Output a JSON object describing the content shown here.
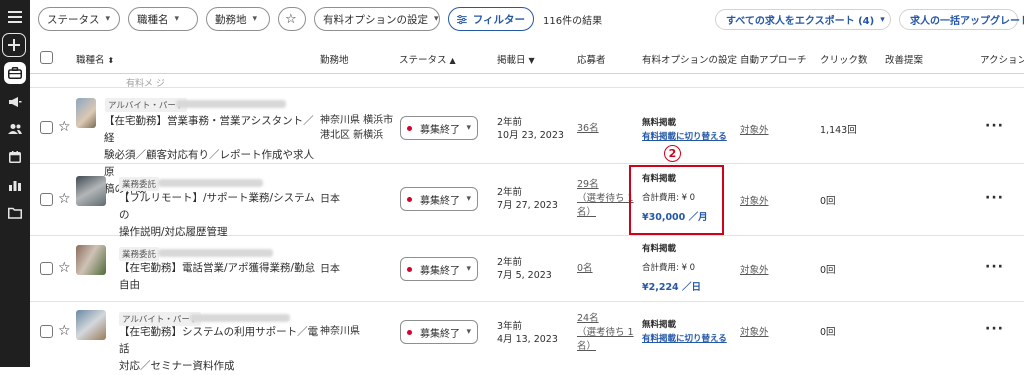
{
  "toolbar": {
    "status": "ステータス",
    "job_category": "職種名",
    "location": "勤務地",
    "paid_option": "有料オプションの設定",
    "filter": "フィルター",
    "results": "116件の結果",
    "export": "すべての求人をエクスポート (4)",
    "bulk_upgrade": "求人の一括アップグレード"
  },
  "columns": {
    "job_title": "職種名",
    "location": "勤務地",
    "status": "ステータス",
    "posted": "掲載日",
    "applicants": "応募者",
    "paid_option": "有料オプションの設定",
    "auto_approach": "自動アプローチ",
    "clicks": "クリック数",
    "suggestions": "改善提案",
    "actions": "アクション"
  },
  "partial_row_text": "有料メ ジ",
  "rows": [
    {
      "job_type": "アルバイト・パート",
      "title_l1": "【在宅勤務】営業事務・営業アシスタント／経",
      "title_l2": "験必須／顧客対応有り／レポート作成や求人原",
      "title_l3": "稿の作成",
      "loc_l1": "神奈川県 横浜市",
      "loc_l2": "港北区 新横浜",
      "status": "募集終了",
      "posted_ago": "2年前",
      "posted_date": "10月 23, 2023",
      "applicants": "36名",
      "option_l1": "無料掲載",
      "option_l2": "有料掲載に切り替える",
      "auto": "対象外",
      "clicks": "1,143回"
    },
    {
      "job_type": "業務委託",
      "title_l1": "【フルリモート】/サポート業務/システムの",
      "title_l2": "操作説明/対応履歴管理",
      "loc_l1": "日本",
      "status": "募集終了",
      "posted_ago": "2年前",
      "posted_date": "7月 27, 2023",
      "appl_l1": "29名",
      "appl_l2": "（選考待ち 1",
      "appl_l3": "名）",
      "option_l1": "有料掲載",
      "option_l2": "合計費用: ¥ 0",
      "option_l3": "¥30,000 ／月",
      "auto": "対象外",
      "clicks": "0回"
    },
    {
      "job_type": "業務委託",
      "title_l1": "【在宅勤務】電話営業/アポ獲得業務/勤怠",
      "title_l2": "自由",
      "loc_l1": "日本",
      "status": "募集終了",
      "posted_ago": "2年前",
      "posted_date": "7月 5, 2023",
      "applicants": "0名",
      "option_l1": "有料掲載",
      "option_l2": "合計費用: ¥ 0",
      "option_l3": "¥2,224 ／日",
      "auto": "対象外",
      "clicks": "0回"
    },
    {
      "job_type": "アルバイト・パート",
      "title_l1": "【在宅勤務】システムの利用サポート／電話",
      "title_l2": "対応／セミナー資料作成",
      "loc_l1": "神奈川県",
      "status": "募集終了",
      "posted_ago": "3年前",
      "posted_date": "4月 13, 2023",
      "appl_l1": "24名",
      "appl_l2": "（選考待ち 1",
      "appl_l3": "名）",
      "option_l1": "無料掲載",
      "option_l2": "有料掲載に切り替える",
      "auto": "対象外",
      "clicks": "0回"
    }
  ],
  "annotation": "2",
  "colors": {
    "accent": "#2557a7",
    "highlight": "#d0021b",
    "status_dot": "#d6002d",
    "sidebar": "#1f1f1f"
  },
  "icons": [
    "menu-icon",
    "plus-icon",
    "briefcase-icon",
    "megaphone-icon",
    "people-icon",
    "calendar-icon",
    "bar-chart-icon",
    "folder-icon",
    "star-icon",
    "filter-icon",
    "chevron-down-icon",
    "more-icon"
  ]
}
